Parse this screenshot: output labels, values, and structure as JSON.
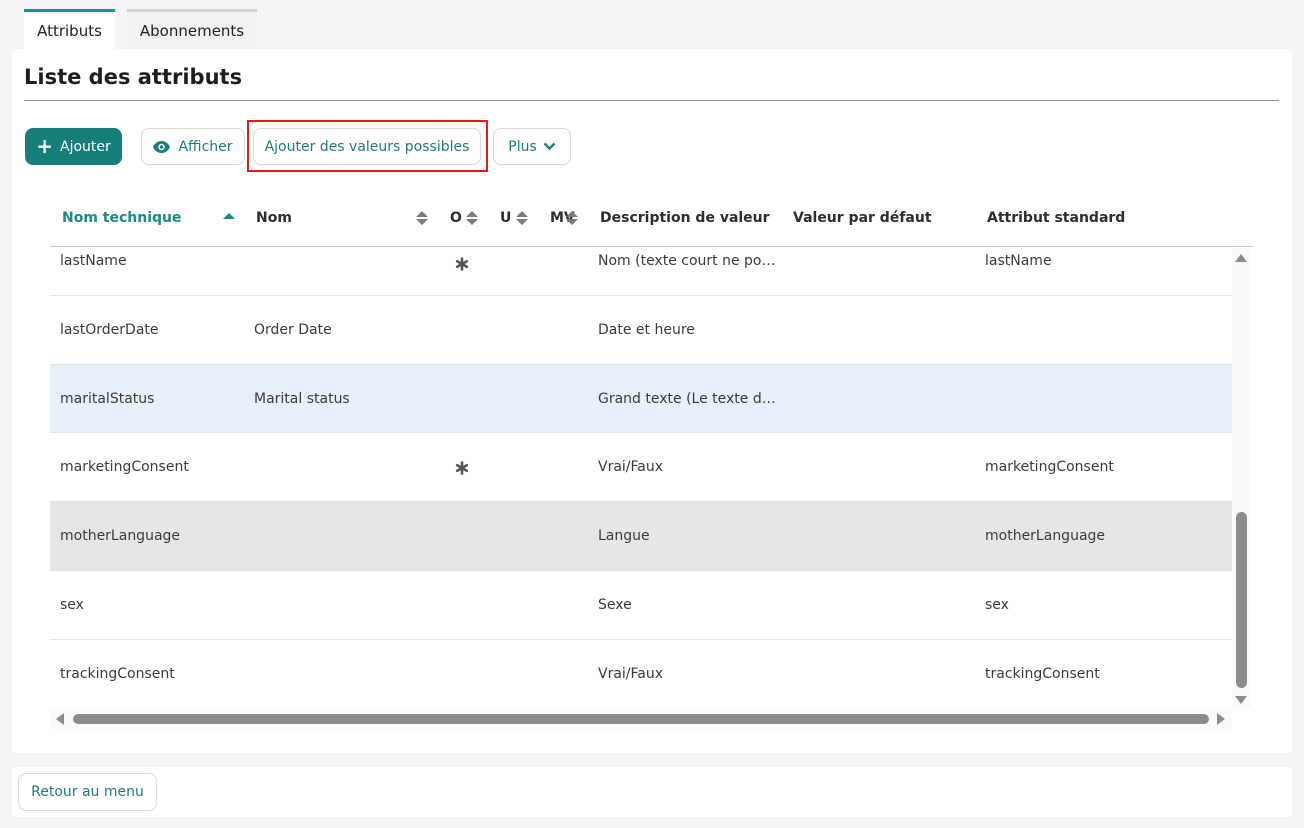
{
  "tabs": [
    {
      "label": "Attributs",
      "active": true
    },
    {
      "label": "Abonnements",
      "active": false
    }
  ],
  "page_title": "Liste des attributs",
  "toolbar": {
    "add_label": "Ajouter",
    "show_label": "Afficher",
    "add_values_label": "Ajouter des valeurs possibles",
    "more_label": "Plus"
  },
  "columns": {
    "technical_name": "Nom technique",
    "name": "Nom",
    "o": "O",
    "u": "U",
    "mv": "MV",
    "value_description": "Description de valeur",
    "default_value": "Valeur par défaut",
    "standard_attribute": "Attribut standard"
  },
  "rows": [
    {
      "technical_name": "lastName",
      "name": "",
      "o_flag": true,
      "value_description": "Nom (texte court ne po…",
      "default_value": "",
      "standard_attribute": "lastName",
      "state": "normal"
    },
    {
      "technical_name": "lastOrderDate",
      "name": "Order Date",
      "o_flag": false,
      "value_description": "Date et heure",
      "default_value": "",
      "standard_attribute": "",
      "state": "normal"
    },
    {
      "technical_name": "maritalStatus",
      "name": "Marital status",
      "o_flag": false,
      "value_description": "Grand texte (Le texte d…",
      "default_value": "",
      "standard_attribute": "",
      "state": "selected"
    },
    {
      "technical_name": "marketingConsent",
      "name": "",
      "o_flag": true,
      "value_description": "Vrai/Faux",
      "default_value": "",
      "standard_attribute": "marketingConsent",
      "state": "normal"
    },
    {
      "technical_name": "motherLanguage",
      "name": "",
      "o_flag": false,
      "value_description": "Langue",
      "default_value": "",
      "standard_attribute": "motherLanguage",
      "state": "hovered"
    },
    {
      "technical_name": "sex",
      "name": "",
      "o_flag": false,
      "value_description": "Sexe",
      "default_value": "",
      "standard_attribute": "sex",
      "state": "normal"
    },
    {
      "technical_name": "trackingConsent",
      "name": "",
      "o_flag": false,
      "value_description": "Vrai/Faux",
      "default_value": "",
      "standard_attribute": "trackingConsent",
      "state": "normal"
    }
  ],
  "footer": {
    "back_label": "Retour au menu"
  },
  "colors": {
    "accent": "#167f7a",
    "highlight_box": "#e11a1a",
    "selected_row": "#e8f1f9",
    "hovered_row": "#e6e6e6"
  }
}
